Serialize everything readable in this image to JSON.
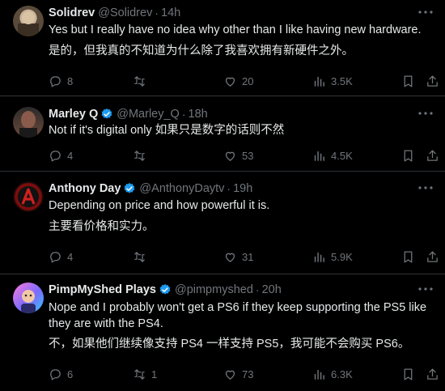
{
  "tweets": [
    {
      "name": "Solidrev",
      "handle": "@Solidrev",
      "time": "14h",
      "verified": false,
      "line1": "Yes but I really have no idea why other than I like having new hardware.",
      "line2": "是的，但我真的不知道为什么除了我喜欢拥有新硬件之外。",
      "replies": "8",
      "retweets": "",
      "likes": "20",
      "views": "3.5K"
    },
    {
      "name": "Marley Q",
      "handle": "@Marley_Q",
      "time": "18h",
      "verified": true,
      "line1": "Not if it's digital only 如果只是数字的话则不然",
      "replies": "4",
      "retweets": "",
      "likes": "53",
      "views": "4.5K"
    },
    {
      "name": "Anthony Day",
      "handle": "@AnthonyDaytv",
      "time": "19h",
      "verified": true,
      "line1": "Depending on price and how powerful it is.",
      "line2": "主要看价格和实力。",
      "replies": "4",
      "retweets": "",
      "likes": "31",
      "views": "5.9K"
    },
    {
      "name": "PimpMyShed Plays",
      "handle": "@pimpmyshed",
      "time": "20h",
      "verified": true,
      "line1": "Nope and I probably won't get a PS6 if they keep supporting the PS5 like",
      "line1b": "they are with the PS4.",
      "line2": "不，如果他们继续像支持 PS4 一样支持 PS5，我可能不会购买 PS6。",
      "replies": "6",
      "retweets": "1",
      "likes": "73",
      "views": "6.3K"
    }
  ],
  "colors": {
    "accent": "#1d9bf0",
    "muted": "#71767b",
    "text": "#e7e9ea",
    "border": "#2f3336",
    "background": "#000000"
  },
  "icons": [
    "reply-icon",
    "retweet-icon",
    "like-icon",
    "views-icon",
    "bookmark-icon",
    "share-icon",
    "more-icon",
    "verified-badge-icon"
  ]
}
